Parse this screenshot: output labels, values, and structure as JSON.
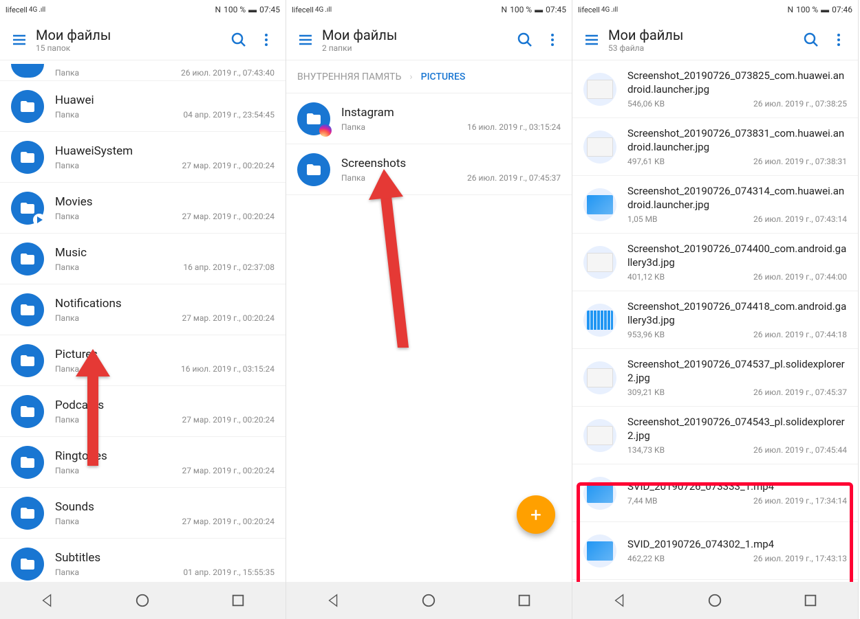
{
  "status": {
    "carrier": "lifecell",
    "network": "4G",
    "nfc": "N",
    "battery": "100 %",
    "time1": "07:45",
    "time2": "07:45",
    "time3": "07:46"
  },
  "app": {
    "title": "Мои файлы",
    "sub1": "15 папок",
    "sub2": "2 папки",
    "sub3": "53 файла"
  },
  "breadcrumb": {
    "parent": "ВНУТРЕННЯЯ ПАМЯТЬ",
    "current": "PICTURES"
  },
  "cutoff": {
    "type": "Папка",
    "date": "26 июл. 2019 г., 07:43:40"
  },
  "panel1": [
    {
      "name": "Huawei",
      "type": "Папка",
      "date": "04 апр. 2019 г., 23:54:45"
    },
    {
      "name": "HuaweiSystem",
      "type": "Папка",
      "date": "27 мар. 2019 г., 00:20:24"
    },
    {
      "name": "Movies",
      "type": "Папка",
      "date": "27 мар. 2019 г., 00:20:24",
      "badge": "play"
    },
    {
      "name": "Music",
      "type": "Папка",
      "date": "16 апр. 2019 г., 02:37:08"
    },
    {
      "name": "Notifications",
      "type": "Папка",
      "date": "27 мар. 2019 г., 00:20:24"
    },
    {
      "name": "Pictures",
      "type": "Папка",
      "date": "16 июл. 2019 г., 03:15:24"
    },
    {
      "name": "Podcasts",
      "type": "Папка",
      "date": "27 мар. 2019 г., 00:20:24"
    },
    {
      "name": "Ringtones",
      "type": "Папка",
      "date": "27 мар. 2019 г., 00:20:24"
    },
    {
      "name": "Sounds",
      "type": "Папка",
      "date": "27 мар. 2019 г., 00:20:24"
    },
    {
      "name": "Subtitles",
      "type": "Папка",
      "date": "01 апр. 2019 г., 15:55:35"
    }
  ],
  "panel2": [
    {
      "name": "Instagram",
      "type": "Папка",
      "date": "16 июл. 2019 г., 03:15:24",
      "badge": "ig"
    },
    {
      "name": "Screenshots",
      "type": "Папка",
      "date": "26 июл. 2019 г., 07:45:37"
    }
  ],
  "panel3": [
    {
      "name": "Screenshot_20190726_073825_com.huawei.android.launcher.jpg",
      "size": "546,06 KB",
      "date": "26 июл. 2019 г., 07:38:25",
      "thumb": "light"
    },
    {
      "name": "Screenshot_20190726_073831_com.huawei.android.launcher.jpg",
      "size": "497,61 KB",
      "date": "26 июл. 2019 г., 07:38:31",
      "thumb": "light"
    },
    {
      "name": "Screenshot_20190726_074314_com.huawei.android.launcher.jpg",
      "size": "1,05 MB",
      "date": "26 июл. 2019 г., 07:43:14",
      "thumb": "blue"
    },
    {
      "name": "Screenshot_20190726_074400_com.android.gallery3d.jpg",
      "size": "401,12 KB",
      "date": "26 июл. 2019 г., 07:44:00",
      "thumb": "light"
    },
    {
      "name": "Screenshot_20190726_074418_com.android.gallery3d.jpg",
      "size": "953,96 KB",
      "date": "26 июл. 2019 г., 07:44:18",
      "thumb": "grid"
    },
    {
      "name": "Screenshot_20190726_074537_pl.solidexplorer2.jpg",
      "size": "309,21 KB",
      "date": "26 июл. 2019 г., 07:45:37",
      "thumb": "light"
    },
    {
      "name": "Screenshot_20190726_074543_pl.solidexplorer2.jpg",
      "size": "134,73 KB",
      "date": "26 июл. 2019 г., 07:45:44",
      "thumb": "light"
    },
    {
      "name": "SVID_20190726_073333_1.mp4",
      "size": "7,44 MB",
      "date": "26 июл. 2019 г., 17:34:14",
      "thumb": "blue"
    },
    {
      "name": "SVID_20190726_074302_1.mp4",
      "size": "462,22 KB",
      "date": "26 июл. 2019 г., 17:43:13",
      "thumb": "blue"
    }
  ]
}
